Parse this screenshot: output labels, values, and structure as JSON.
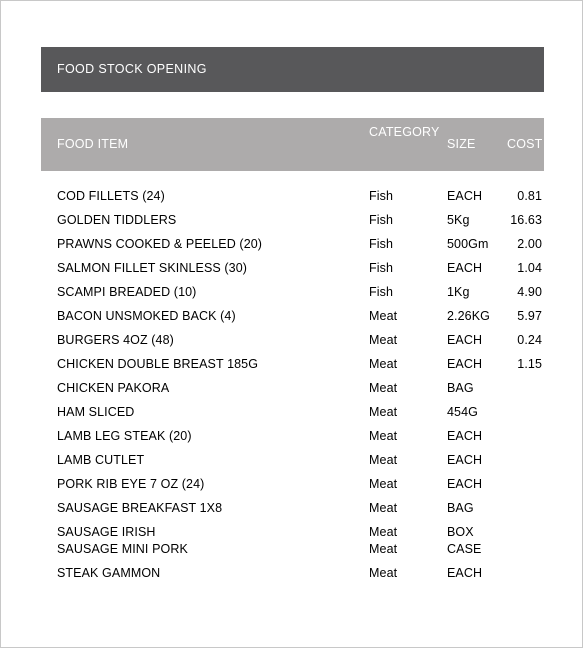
{
  "document": {
    "title_band": {
      "label": "FOOD STOCK OPENING",
      "background_color": "#58585a",
      "text_color": "#ffffff"
    },
    "table": {
      "header_background_color": "#adabab",
      "header_text_color": "#ffffff",
      "columns": [
        {
          "key": "item",
          "label": "FOOD ITEM"
        },
        {
          "key": "category",
          "label": "CATEGORY"
        },
        {
          "key": "size",
          "label": "SIZE"
        },
        {
          "key": "cost",
          "label": "COST"
        }
      ],
      "rows": [
        {
          "item": "COD FILLETS (24)",
          "category": "Fish",
          "size": "EACH",
          "cost": "0.81",
          "tight": false
        },
        {
          "item": "GOLDEN TIDDLERS",
          "category": "Fish",
          "size": "5Kg",
          "cost": "16.63",
          "tight": false
        },
        {
          "item": "PRAWNS COOKED & PEELED (20)",
          "category": "Fish",
          "size": "500Gm",
          "cost": "2.00",
          "tight": false
        },
        {
          "item": "SALMON FILLET SKINLESS (30)",
          "category": "Fish",
          "size": "EACH",
          "cost": "1.04",
          "tight": false
        },
        {
          "item": "SCAMPI BREADED (10)",
          "category": "Fish",
          "size": "1Kg",
          "cost": "4.90",
          "tight": false
        },
        {
          "item": "BACON UNSMOKED BACK (4)",
          "category": "Meat",
          "size": "2.26KG",
          "cost": "5.97",
          "tight": false
        },
        {
          "item": "BURGERS 4OZ (48)",
          "category": "Meat",
          "size": "EACH",
          "cost": "0.24",
          "tight": false
        },
        {
          "item": "CHICKEN DOUBLE BREAST 185G",
          "category": "Meat",
          "size": "EACH",
          "cost": "1.15",
          "tight": false
        },
        {
          "item": "CHICKEN PAKORA",
          "category": "Meat",
          "size": "BAG",
          "cost": "",
          "tight": false
        },
        {
          "item": "HAM SLICED",
          "category": "Meat",
          "size": "454G",
          "cost": "",
          "tight": false
        },
        {
          "item": "LAMB LEG STEAK (20)",
          "category": "Meat",
          "size": "EACH",
          "cost": "",
          "tight": false
        },
        {
          "item": "LAMB CUTLET",
          "category": "Meat",
          "size": "EACH",
          "cost": "",
          "tight": false
        },
        {
          "item": "PORK RIB EYE 7 OZ (24)",
          "category": "Meat",
          "size": "EACH",
          "cost": "",
          "tight": false
        },
        {
          "item": "SAUSAGE BREAKFAST 1X8",
          "category": "Meat",
          "size": "BAG",
          "cost": "",
          "tight": false
        },
        {
          "item": "SAUSAGE IRISH",
          "category": "Meat",
          "size": "BOX",
          "cost": "",
          "tight": true
        },
        {
          "item": "SAUSAGE MINI PORK",
          "category": "Meat",
          "size": "CASE",
          "cost": "",
          "tight": false
        },
        {
          "item": "STEAK GAMMON",
          "category": "Meat",
          "size": "EACH",
          "cost": "",
          "tight": false
        }
      ]
    }
  }
}
